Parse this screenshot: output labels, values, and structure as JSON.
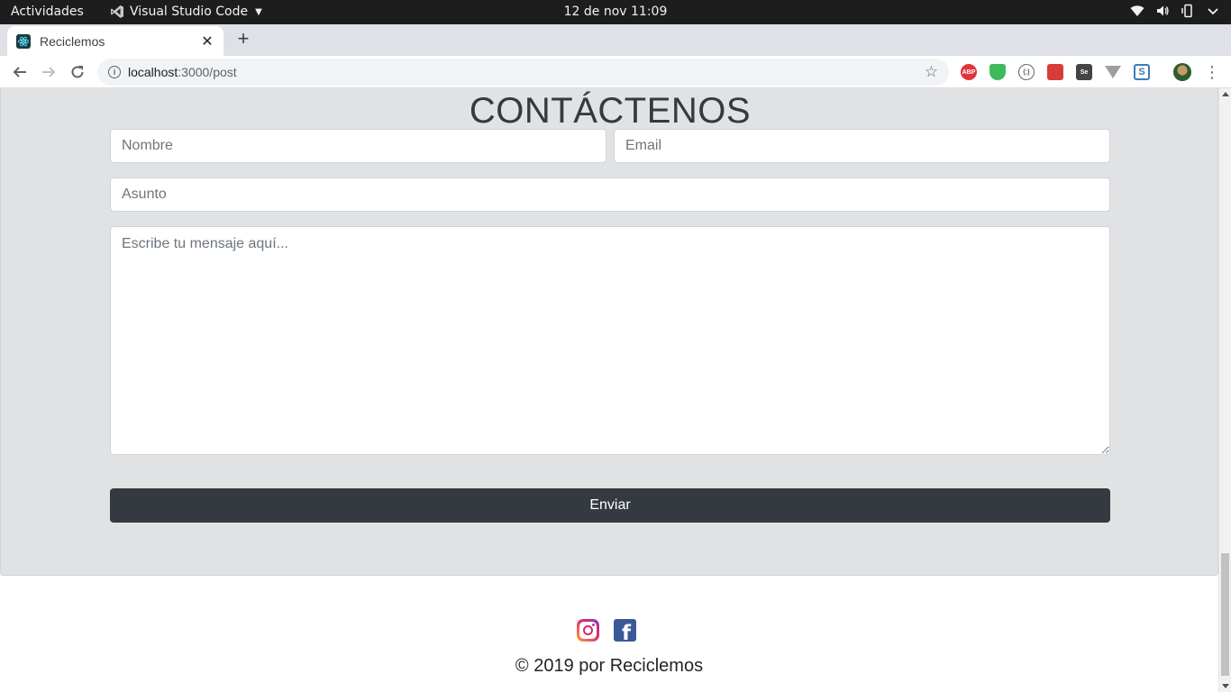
{
  "system_bar": {
    "activities": "Actividades",
    "app_name": "Visual Studio Code",
    "clock": "12 de nov  11:09"
  },
  "browser": {
    "tab_title": "Reciclemos",
    "url_host": "localhost",
    "url_path": ":3000/post",
    "extensions": [
      {
        "name": "adblock-plus-icon",
        "label": "ABP",
        "color": "#e0343b"
      },
      {
        "name": "shield-extension-icon",
        "label": "",
        "color": "#3dba5c"
      },
      {
        "name": "json-viewer-icon",
        "label": "{;}",
        "color": "#5f6368"
      },
      {
        "name": "red-extension-icon",
        "label": "",
        "color": "#d93a3a"
      },
      {
        "name": "selenium-ide-icon",
        "label": "Se",
        "color": "#444444"
      },
      {
        "name": "vuejs-devtools-icon",
        "label": "",
        "color": "#9e9e9e"
      },
      {
        "name": "s-extension-icon",
        "label": "S",
        "color": "#3b7bbf"
      }
    ]
  },
  "contact": {
    "heading": "CONTÁCTENOS",
    "name_placeholder": "Nombre",
    "email_placeholder": "Email",
    "subject_placeholder": "Asunto",
    "message_placeholder": "Escribe tu mensaje aquí...",
    "submit_label": "Enviar"
  },
  "footer": {
    "copyright": "© 2019 por Reciclemos"
  },
  "colors": {
    "section_background": "#e1e2e4",
    "button_dark": "#343a40",
    "facebook": "#3b5998"
  }
}
